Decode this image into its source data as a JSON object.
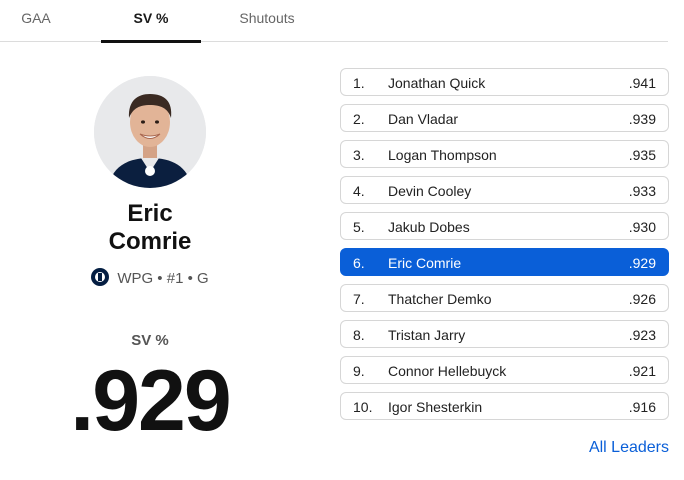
{
  "tabs": [
    {
      "label": "GAA",
      "active": false
    },
    {
      "label": "SV %",
      "active": true
    },
    {
      "label": "Shutouts",
      "active": false
    }
  ],
  "player": {
    "first_name": "Eric",
    "last_name": "Comrie",
    "meta": "WPG • #1 • G",
    "team_logo": "jets-logo"
  },
  "stat": {
    "label": "SV %",
    "value": ".929"
  },
  "leaders": [
    {
      "rank": "1.",
      "name": "Jonathan Quick",
      "value": ".941"
    },
    {
      "rank": "2.",
      "name": "Dan Vladar",
      "value": ".939"
    },
    {
      "rank": "3.",
      "name": "Logan Thompson",
      "value": ".935"
    },
    {
      "rank": "4.",
      "name": "Devin Cooley",
      "value": ".933"
    },
    {
      "rank": "5.",
      "name": "Jakub Dobes",
      "value": ".930"
    },
    {
      "rank": "6.",
      "name": "Eric Comrie",
      "value": ".929",
      "active": true
    },
    {
      "rank": "7.",
      "name": "Thatcher Demko",
      "value": ".926"
    },
    {
      "rank": "8.",
      "name": "Tristan Jarry",
      "value": ".923"
    },
    {
      "rank": "9.",
      "name": "Connor Hellebuyck",
      "value": ".921"
    },
    {
      "rank": "10.",
      "name": "Igor Shesterkin",
      "value": ".916"
    }
  ],
  "links": {
    "all_leaders": "All Leaders"
  },
  "colors": {
    "accent": "#0a5fd8",
    "text": "#1a1a1a"
  }
}
